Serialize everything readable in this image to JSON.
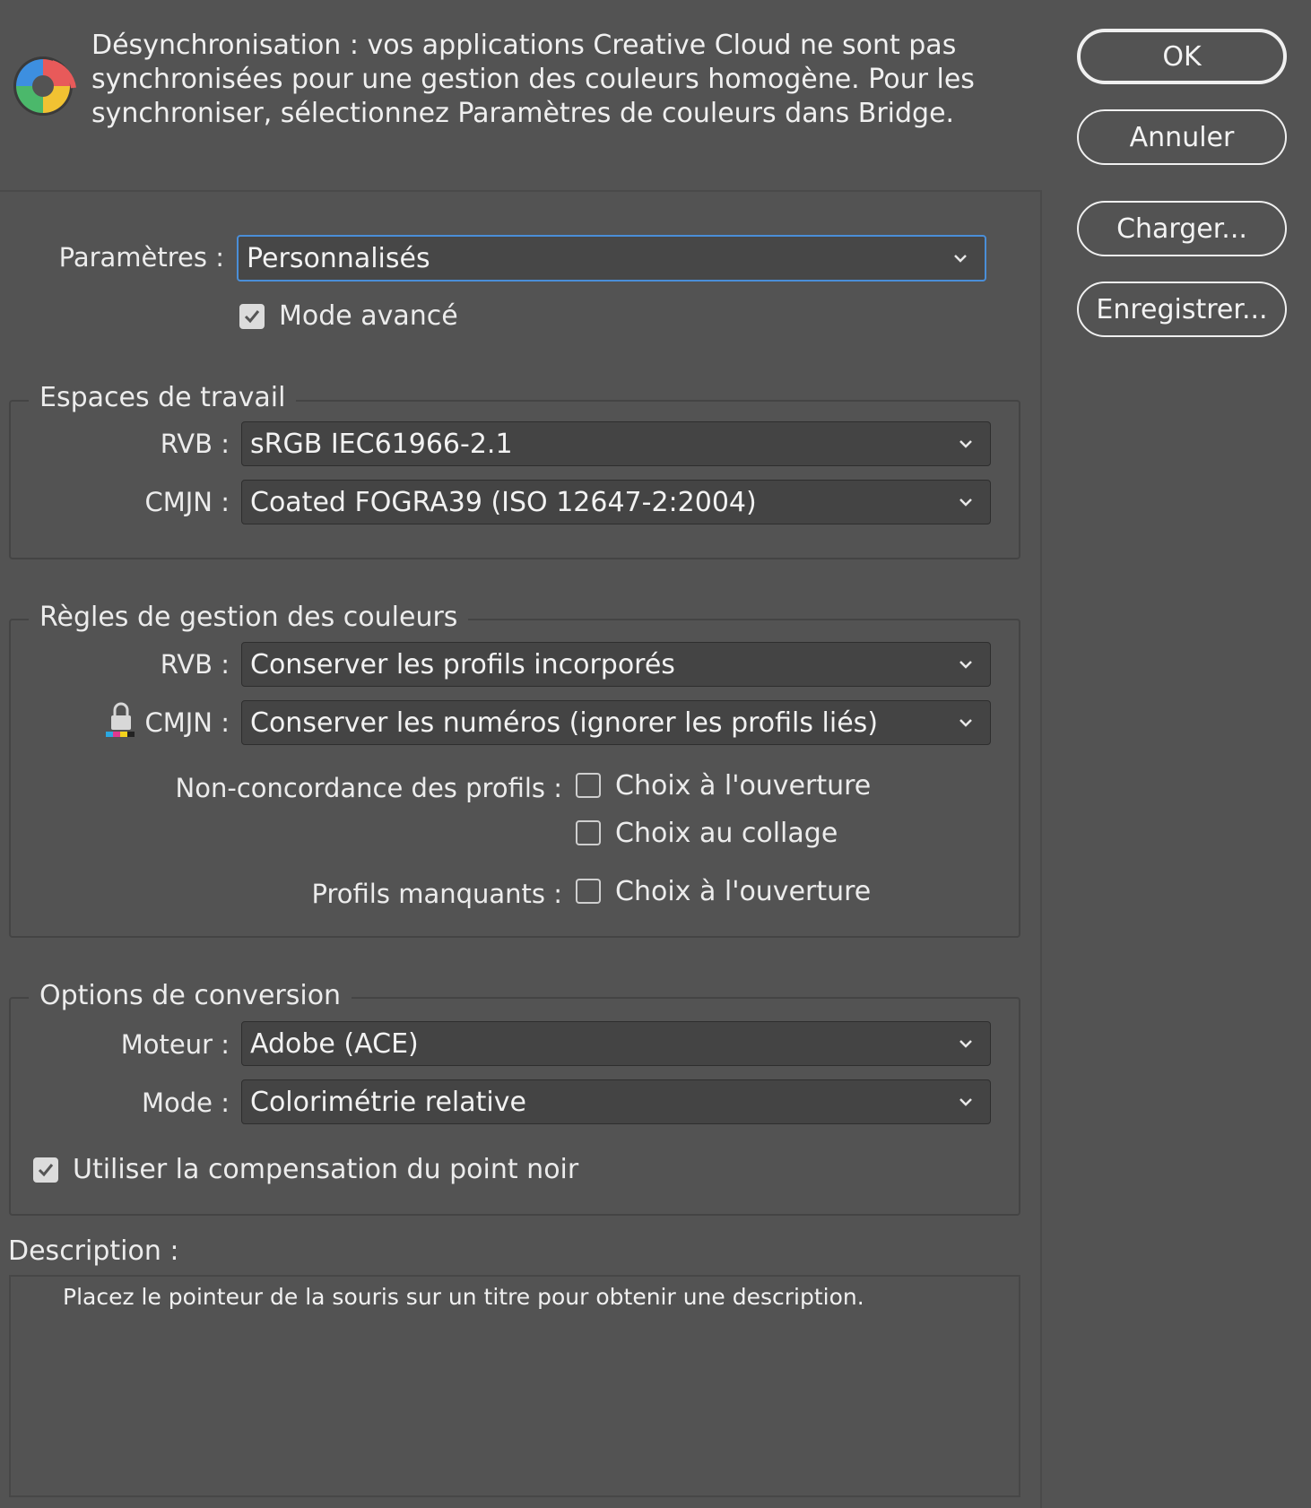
{
  "warning": {
    "icon": "color-sync-icon",
    "text": "Désynchronisation : vos applications Creative Cloud ne sont pas synchronisées pour une gestion des couleurs homogène. Pour les synchroniser, sélectionnez Paramètres de couleurs dans Bridge."
  },
  "buttons": {
    "ok": "OK",
    "cancel": "Annuler",
    "load": "Charger...",
    "save": "Enregistrer..."
  },
  "settings": {
    "label": "Paramètres :",
    "value": "Personnalisés",
    "advanced_mode": {
      "label": "Mode avancé",
      "checked": true
    }
  },
  "working_spaces": {
    "title": "Espaces de travail",
    "rgb": {
      "label": "RVB :",
      "value": "sRGB IEC61966-2.1"
    },
    "cmyk": {
      "label": "CMJN :",
      "value": "Coated FOGRA39 (ISO 12647-2:2004)"
    }
  },
  "color_management_policies": {
    "title": "Règles de gestion des couleurs",
    "rgb": {
      "label": "RVB :",
      "value": "Conserver les profils incorporés"
    },
    "cmyk": {
      "label": "CMJN :",
      "value": "Conserver les numéros (ignorer les profils liés)",
      "icon": "lock-icon"
    },
    "profile_mismatch": {
      "label": "Non-concordance des profils :",
      "ask_when_opening": {
        "label": "Choix à l'ouverture",
        "checked": false
      },
      "ask_when_pasting": {
        "label": "Choix au collage",
        "checked": false
      }
    },
    "missing_profiles": {
      "label": "Profils manquants :",
      "ask_when_opening": {
        "label": "Choix à l'ouverture",
        "checked": false
      }
    }
  },
  "conversion_options": {
    "title": "Options de conversion",
    "engine": {
      "label": "Moteur :",
      "value": "Adobe (ACE)"
    },
    "intent": {
      "label": "Mode :",
      "value": "Colorimétrie relative"
    },
    "black_point": {
      "label": "Utiliser la compensation du point noir",
      "checked": true
    }
  },
  "description": {
    "label": "Description :",
    "text": "Placez le pointeur de la souris sur un titre pour obtenir une description."
  },
  "colors": {
    "background": "#535353",
    "focus_ring": "#4a8ed8",
    "text": "#ececec"
  }
}
